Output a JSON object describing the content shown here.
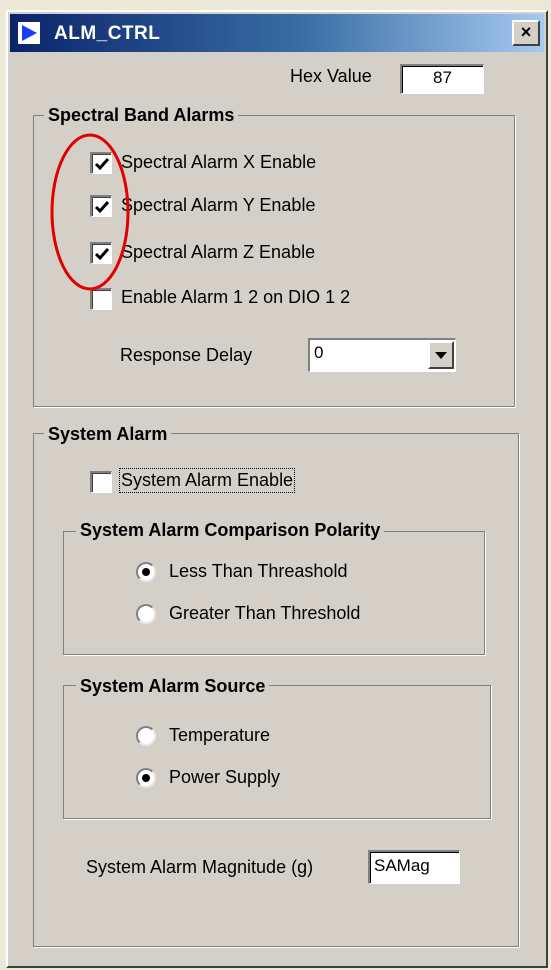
{
  "window": {
    "title": "ALM_CTRL",
    "close_label": "×"
  },
  "hex": {
    "label": "Hex Value",
    "value": "87"
  },
  "spectral": {
    "legend": "Spectral Band Alarms",
    "items": [
      {
        "label": "Spectral Alarm X Enable",
        "checked": true
      },
      {
        "label": "Spectral Alarm Y Enable",
        "checked": true
      },
      {
        "label": "Spectral Alarm Z Enable",
        "checked": true
      },
      {
        "label": "Enable Alarm 1  2 on DIO 1 2",
        "checked": false
      }
    ],
    "response_delay_label": "Response Delay",
    "response_delay_value": "0"
  },
  "system": {
    "legend": "System Alarm",
    "enable_label": "System Alarm Enable",
    "enable_checked": false,
    "polarity": {
      "legend": "System Alarm Comparison Polarity",
      "options": [
        "Less Than Threashold",
        "Greater Than Threshold"
      ],
      "selected": "Less Than Threashold"
    },
    "source": {
      "legend": "System Alarm Source",
      "options": [
        "Temperature",
        "Power Supply"
      ],
      "selected": "Power Supply"
    },
    "magnitude_label": "System Alarm Magnitude (g)",
    "magnitude_value": "SAMag"
  },
  "colors": {
    "annotation": "#e00000",
    "title_start": "#0a246a",
    "title_end": "#a6caf0"
  }
}
